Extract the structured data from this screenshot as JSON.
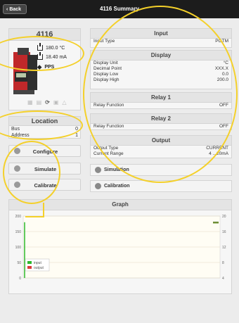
{
  "window": {
    "title": "4116 Summary",
    "back_label": "Back"
  },
  "device": {
    "name": "4116",
    "readings": [
      "180.0 °C",
      "18.40 mA"
    ],
    "tag": "PPS"
  },
  "location": {
    "title": "Location",
    "rows": [
      {
        "label": "Bus",
        "value": "0"
      },
      {
        "label": "Address",
        "value": "1"
      }
    ]
  },
  "actions": {
    "configure": "Configure",
    "simulate": "Simulate",
    "calibrate": "Calibrate"
  },
  "panels": {
    "input": {
      "title": "Input",
      "rows": [
        {
          "label": "Input Type",
          "value": "POTM"
        }
      ]
    },
    "display": {
      "title": "Display",
      "rows": [
        {
          "label": "Display Unit",
          "value": "°C"
        },
        {
          "label": "Decimal Point",
          "value": "XXX.X"
        },
        {
          "label": "Display Low",
          "value": "0.0"
        },
        {
          "label": "Display High",
          "value": "200.0"
        }
      ]
    },
    "relay1": {
      "title": "Relay 1",
      "rows": [
        {
          "label": "Relay Function",
          "value": "OFF"
        }
      ]
    },
    "relay2": {
      "title": "Relay 2",
      "rows": [
        {
          "label": "Relay Function",
          "value": "OFF"
        }
      ]
    },
    "output": {
      "title": "Output",
      "rows": [
        {
          "label": "Output Type",
          "value": "CURRENT"
        },
        {
          "label": "Current Range",
          "value": "4 .. 20mA"
        }
      ]
    }
  },
  "side_actions": {
    "simulation": "Simulation",
    "calibration": "Calibration"
  },
  "graph": {
    "title": "Graph",
    "legend": [
      {
        "name": "input",
        "color": "#2db82d"
      },
      {
        "name": "output",
        "color": "#d93a3a"
      }
    ]
  },
  "chart_data": {
    "type": "line",
    "title": "Graph",
    "xlabel": "",
    "ylabel": "",
    "y_left_ticks": [
      0,
      50,
      100,
      150,
      200
    ],
    "y_right_ticks": [
      4,
      8,
      12,
      16,
      20
    ],
    "ylim_left": [
      0,
      200
    ],
    "ylim_right": [
      4,
      20
    ],
    "series": [
      {
        "name": "input",
        "axis": "left",
        "color": "#2db82d",
        "values": [
          180
        ]
      },
      {
        "name": "output",
        "axis": "right",
        "color": "#d93a3a",
        "values": [
          18.4
        ]
      }
    ],
    "grid": true,
    "legend_position": "bottom-left"
  },
  "colors": {
    "highlight": "#f4d02a",
    "topbar": "#1c1c1c",
    "device_red": "#c0282a",
    "device_gray": "#4a4a4a"
  }
}
